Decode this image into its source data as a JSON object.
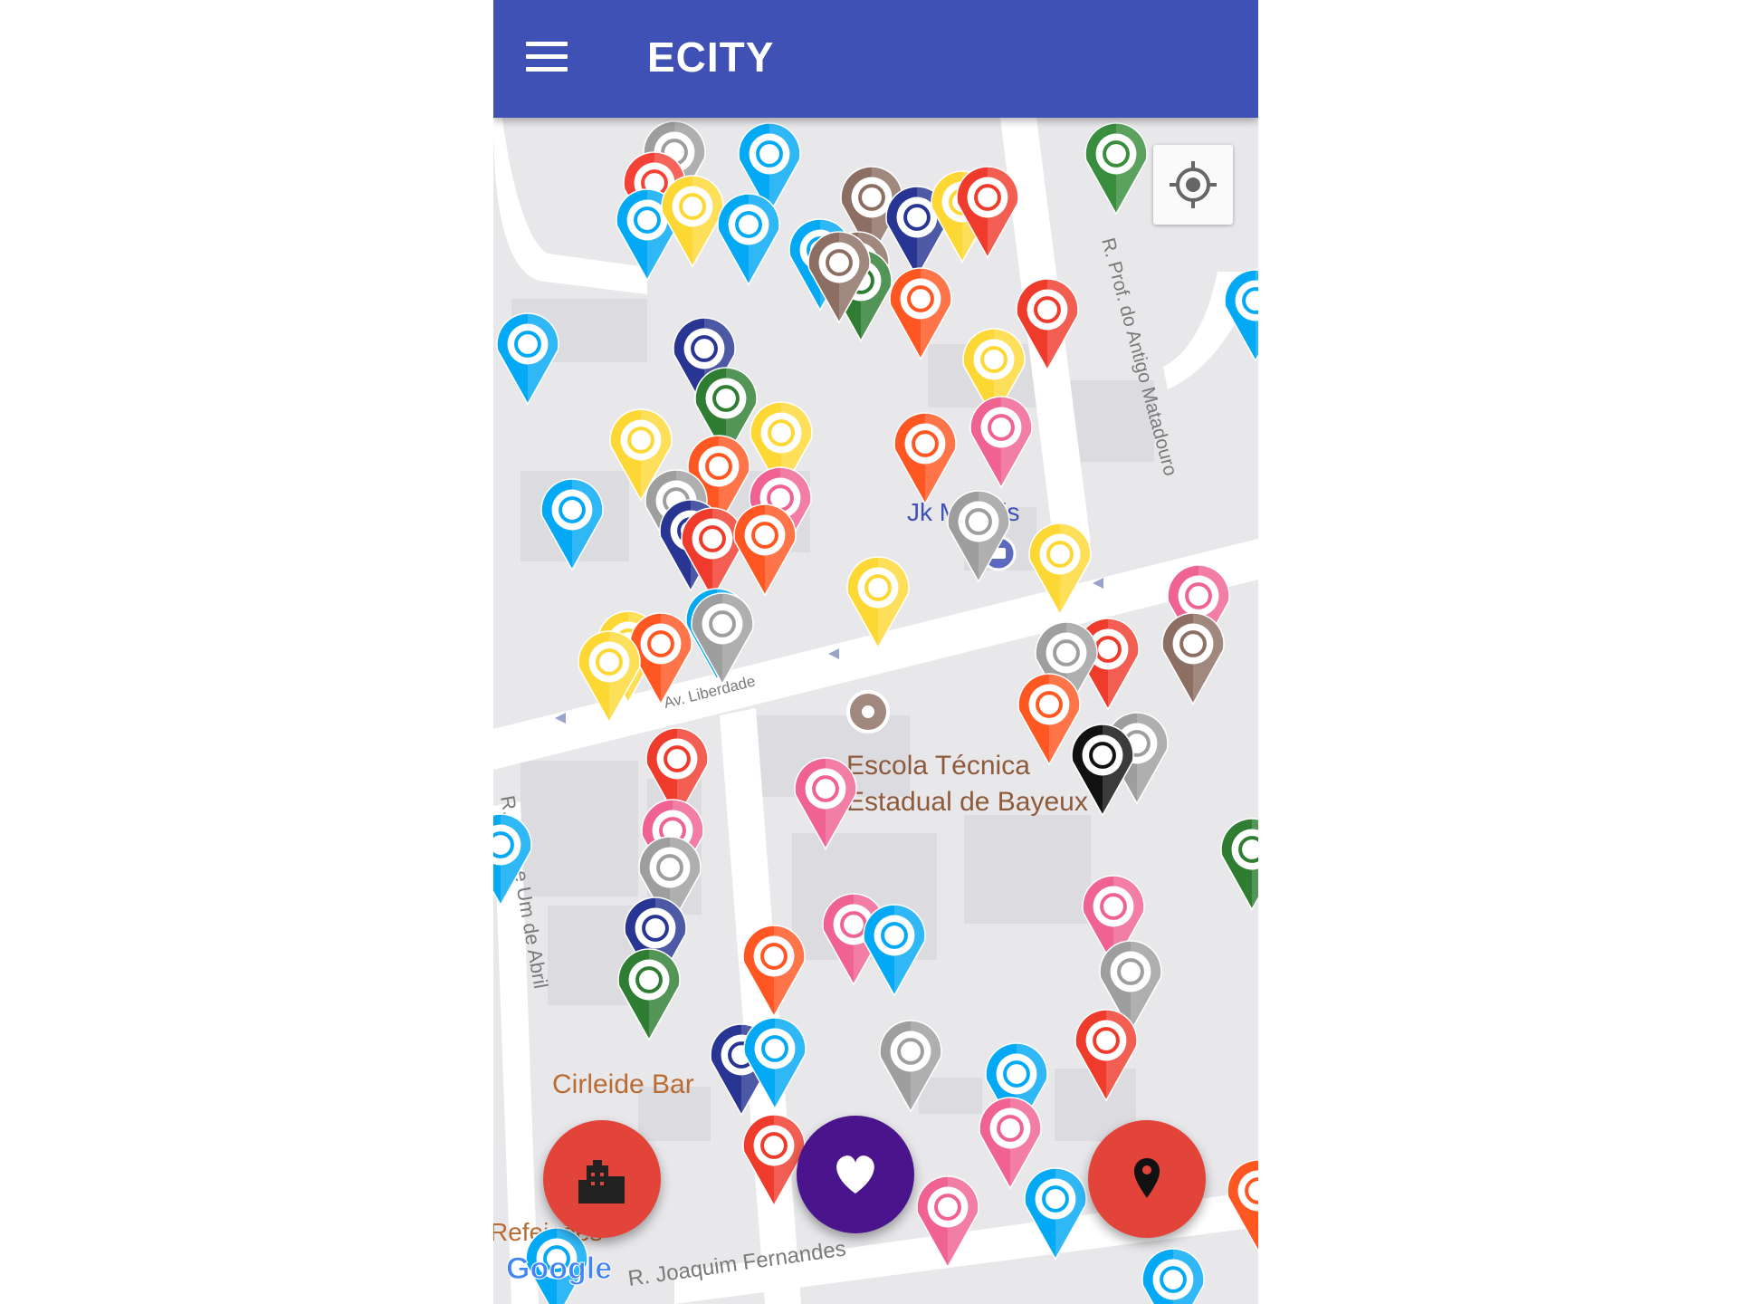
{
  "app": {
    "title": "ECITY",
    "theme_color": "#3f51b5",
    "menu_icon": "hamburger-menu-icon"
  },
  "map": {
    "street_labels": {
      "rua_prof": "R. Prof. do Antigo Matadouro",
      "av_liberdade": "Av. Liberdade",
      "rua_abril": "R. Vinte e Um de Abril",
      "rua_joaquim": "R. Joaquim Fernandes"
    },
    "place_labels": {
      "jk": "Jk Moveis",
      "escola_line1": "Escola Técnica",
      "escola_line2": "Estadual de Bayeux",
      "cirleide": "Cirleide Bar",
      "refeicoes": "Refeições"
    },
    "attribution": "Google",
    "markers": [
      {
        "color": "#9e9e9e",
        "icon": "shell-icon"
      },
      {
        "color": "#03a9f4",
        "icon": "flood-icon"
      },
      {
        "color": "#8d6e63",
        "icon": "trash-icon"
      },
      {
        "color": "#388e3c",
        "icon": "tree-icon"
      },
      {
        "color": "#f44336",
        "icon": "fire-icon"
      },
      {
        "color": "#03a9f4",
        "icon": "no-parking-icon"
      },
      {
        "color": "#fdd835",
        "icon": "gallows-icon"
      },
      {
        "color": "#03a9f4",
        "icon": "water-drop-icon"
      },
      {
        "color": "#8d6e63",
        "icon": "garbage-pile-icon"
      },
      {
        "color": "#283593",
        "icon": "school-icon"
      },
      {
        "color": "#fdd835",
        "icon": "power-pole-icon"
      },
      {
        "color": "#ef3b2c",
        "icon": "power-outage-icon"
      },
      {
        "color": "#03a9f4",
        "icon": "pipe-leak-icon"
      },
      {
        "color": "#2e7d32",
        "icon": "birdcage-icon"
      },
      {
        "color": "#ff5722",
        "icon": "robbery-icon"
      },
      {
        "color": "#8d6e63",
        "icon": "debris-icon"
      },
      {
        "color": "#03a9f4",
        "icon": "alert-icon"
      },
      {
        "color": "#03a9f4",
        "icon": "faucet-icon"
      },
      {
        "color": "#283593",
        "icon": "no-smoking-icon"
      },
      {
        "color": "#ef3b2c",
        "icon": "power-outage-icon"
      },
      {
        "color": "#fdd835",
        "icon": "no-light-icon"
      },
      {
        "color": "#2e7d32",
        "icon": "question-icon"
      },
      {
        "color": "#fdd835",
        "icon": "gallows-icon"
      },
      {
        "color": "#fdd835",
        "icon": "gallows-icon"
      },
      {
        "color": "#ff5722",
        "icon": "police-icon"
      },
      {
        "color": "#ff5722",
        "icon": "police-icon"
      },
      {
        "color": "#f06292",
        "icon": "protest-icon"
      },
      {
        "color": "#03a9f4",
        "icon": "water-drop-icon"
      },
      {
        "color": "#f06292",
        "icon": "accident-icon"
      },
      {
        "color": "#9e9e9e",
        "icon": "shell-icon"
      },
      {
        "color": "#283593",
        "icon": "meeting-icon"
      },
      {
        "color": "#ef3b2c",
        "icon": "question-icon"
      },
      {
        "color": "#ff5722",
        "icon": "question-icon"
      },
      {
        "color": "#9e9e9e",
        "icon": "streetlight-icon"
      },
      {
        "color": "#fdd835",
        "icon": "no-light-icon"
      },
      {
        "color": "#fdd835",
        "icon": "gallows-icon"
      },
      {
        "color": "#f06292",
        "icon": "accident-icon"
      },
      {
        "color": "#fdd835",
        "icon": "gallows-icon"
      },
      {
        "color": "#03a9f4",
        "icon": "flood-icon"
      },
      {
        "color": "#9e9e9e",
        "icon": "traffic-light-icon"
      },
      {
        "color": "#ff5722",
        "icon": "robbery-icon"
      },
      {
        "color": "#fdd835",
        "icon": "gallows-icon"
      },
      {
        "color": "#ef3b2c",
        "icon": "assault-icon"
      },
      {
        "color": "#9e9e9e",
        "icon": "streetlight-icon"
      },
      {
        "color": "#8d6e63",
        "icon": "garbage-pile-icon"
      },
      {
        "color": "#ff5722",
        "icon": "thief-icon"
      },
      {
        "color": "#9e9e9e",
        "icon": "bus-icon"
      },
      {
        "color": "#111111",
        "icon": "question-icon"
      },
      {
        "color": "#ef3b2c",
        "icon": "violence-icon"
      },
      {
        "color": "#f06292",
        "icon": "protest-icon"
      },
      {
        "color": "#f06292",
        "icon": "protest-icon"
      },
      {
        "color": "#03a9f4",
        "icon": "flood-icon"
      },
      {
        "color": "#9e9e9e",
        "icon": "shell-icon"
      },
      {
        "color": "#2e7d32",
        "icon": "tree-icon"
      },
      {
        "color": "#283593",
        "icon": "school-icon"
      },
      {
        "color": "#2e7d32",
        "icon": "fire-icon"
      },
      {
        "color": "#f06292",
        "icon": "protest-icon"
      },
      {
        "color": "#03a9f4",
        "icon": "water-drop-icon"
      },
      {
        "color": "#ff5722",
        "icon": "robbery-icon"
      },
      {
        "color": "#f06292",
        "icon": "question-icon"
      },
      {
        "color": "#9e9e9e",
        "icon": "car-icon"
      },
      {
        "color": "#283593",
        "icon": "school-icon"
      },
      {
        "color": "#03a9f4",
        "icon": "building-icon"
      },
      {
        "color": "#9e9e9e",
        "icon": "bus-icon"
      },
      {
        "color": "#03a9f4",
        "icon": "water-drop-icon"
      },
      {
        "color": "#ef3b2c",
        "icon": "no-entry-icon"
      },
      {
        "color": "#f06292",
        "icon": "protest-icon"
      },
      {
        "color": "#ef3b2c",
        "icon": "alert-icon"
      },
      {
        "color": "#ff5722",
        "icon": "police-icon"
      },
      {
        "color": "#03a9f4",
        "icon": "faucet-icon"
      },
      {
        "color": "#03a9f4",
        "icon": "question-icon"
      },
      {
        "color": "#f06292",
        "icon": "accident-icon"
      },
      {
        "color": "#03a9f4",
        "icon": "flood-icon"
      }
    ]
  },
  "buttons": {
    "locate": {
      "icon": "my-location-icon"
    },
    "city": {
      "icon": "city-icon",
      "color": "#e2443a"
    },
    "favorite": {
      "icon": "heart-icon",
      "color": "#4a148c"
    },
    "add_location": {
      "icon": "location-pin-icon",
      "color": "#e2443a"
    }
  }
}
